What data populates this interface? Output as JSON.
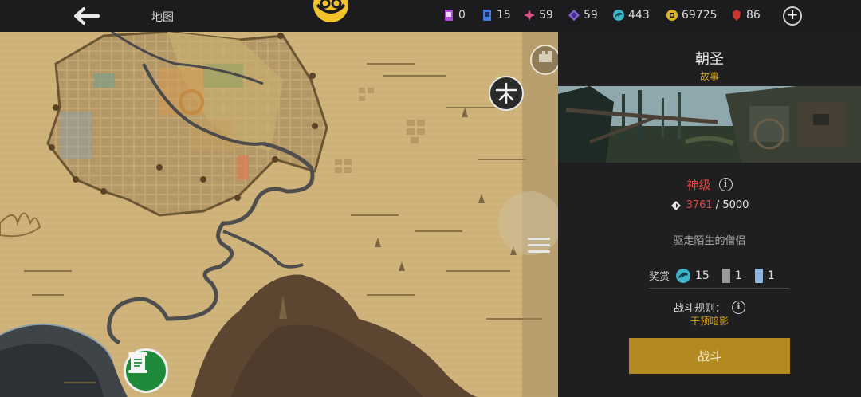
{
  "header": {
    "title": "地图",
    "back_icon": "arrow-left-icon",
    "emblem_icon": "faction-emblem-icon",
    "resources": [
      {
        "name": "purple-card",
        "icon": "purple-card-icon",
        "value": "0",
        "color": "#b04fd8"
      },
      {
        "name": "blue-card",
        "icon": "blue-card-icon",
        "value": "15",
        "color": "#3f7be0"
      },
      {
        "name": "pink-shard",
        "icon": "pink-shard-icon",
        "value": "59",
        "color": "#e0508a"
      },
      {
        "name": "violet-gem",
        "icon": "violet-gem-icon",
        "value": "59",
        "color": "#8a63d8"
      },
      {
        "name": "teal-orb",
        "icon": "teal-orb-icon",
        "value": "443",
        "color": "#3fb3c8"
      },
      {
        "name": "gold-coin",
        "icon": "gold-coin-icon",
        "value": "69725",
        "color": "#d9b42a"
      },
      {
        "name": "red-gem",
        "icon": "red-gem-icon",
        "value": "86",
        "color": "#c9352e"
      }
    ],
    "add_icon": "plus-icon",
    "add_label": "+"
  },
  "map": {
    "compass_icon": "compass-icon",
    "menu_icon": "hamburger-icon",
    "quest_marker_icon": "scroll-icon"
  },
  "mission": {
    "title": "朝圣",
    "type": "故事",
    "difficulty": "神级",
    "power_current": "3761",
    "power_separator": " / ",
    "power_required": "5000",
    "objective": "驱走陌生的僧侣",
    "rewards_label": "奖赏",
    "rewards": [
      {
        "icon": "teal-orb-icon",
        "count": "15",
        "color": "#3fb3c8"
      },
      {
        "icon": "gray-card-icon",
        "count": "1",
        "color": "#9a9a9a"
      },
      {
        "icon": "blue-card-icon",
        "count": "1",
        "color": "#8fb6e0"
      }
    ],
    "rules_label": "战斗规则：",
    "rules_value": "干预暗影",
    "fight_label": "战斗",
    "info_label": "i"
  },
  "colors": {
    "accent_gold": "#d4a017",
    "button_gold": "#b38a1f",
    "danger_red": "#e0463b",
    "quest_green": "#1e8a3a"
  }
}
